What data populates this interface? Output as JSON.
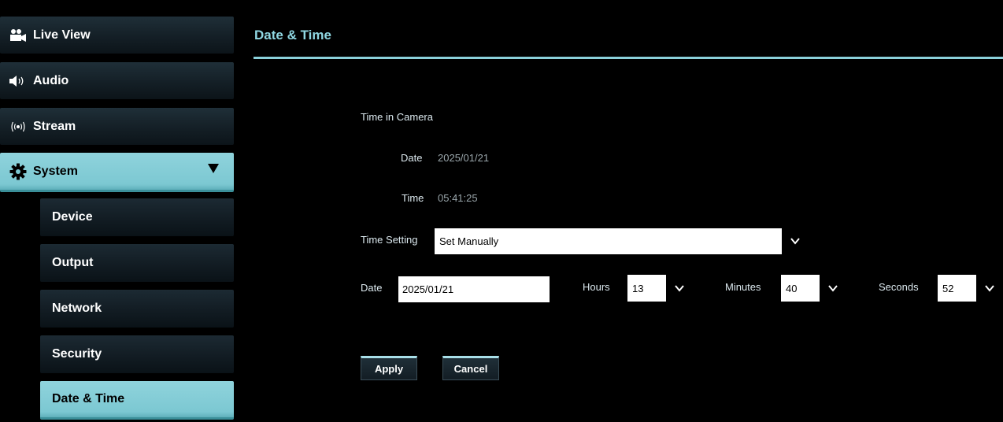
{
  "sidebar": {
    "items": [
      {
        "label": "Live View",
        "icon": "camera-icon"
      },
      {
        "label": "Audio",
        "icon": "speaker-icon"
      },
      {
        "label": "Stream",
        "icon": "broadcast-icon"
      },
      {
        "label": "System",
        "icon": "gear-icon"
      }
    ],
    "system_sub": [
      {
        "label": "Device"
      },
      {
        "label": "Output"
      },
      {
        "label": "Network"
      },
      {
        "label": "Security"
      },
      {
        "label": "Date & Time"
      }
    ]
  },
  "main": {
    "title": "Date & Time",
    "time_in_camera": {
      "label": "Time in Camera",
      "date_label": "Date",
      "date_value": "2025/01/21",
      "time_label": "Time",
      "time_value": "05:41:25"
    },
    "time_setting": {
      "label": "Time Setting",
      "value": "Set Manually"
    },
    "manual": {
      "date_label": "Date",
      "date_value": "2025/01/21",
      "hours_label": "Hours",
      "hours_value": "13",
      "minutes_label": "Minutes",
      "minutes_value": "40",
      "seconds_label": "Seconds",
      "seconds_value": "52"
    },
    "buttons": {
      "apply": "Apply",
      "cancel": "Cancel"
    }
  },
  "colors": {
    "accent": "#8ad0da",
    "title": "#8fd7e2",
    "active_bg": "#7cc8d2",
    "nav_bg": "#17232b"
  }
}
